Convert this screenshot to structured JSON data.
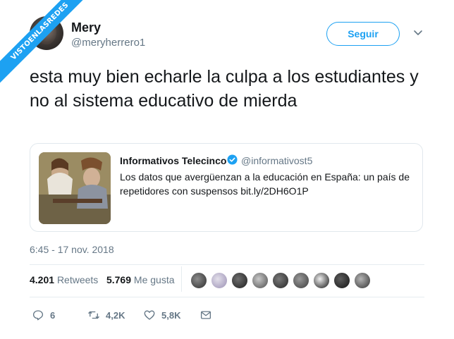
{
  "watermark": "VISTOENLASREDES",
  "author": {
    "name": "Mery",
    "handle": "@meryherrero1",
    "follow_label": "Seguir"
  },
  "tweet": {
    "text": "esta muy bien echarle la culpa a los estudiantes y no al sistema educativo de mierda",
    "timestamp": "6:45 - 17 nov. 2018"
  },
  "quoted": {
    "name": "Informativos Telecinco",
    "handle": "@informativost5",
    "text": "Los datos que avergüenzan a la educación en España: un país de repetidores con suspensos bit.ly/2DH6O1P"
  },
  "stats": {
    "retweets_count": "4.201",
    "retweets_label": "Retweets",
    "likes_count": "5.769",
    "likes_label": "Me gusta"
  },
  "actions": {
    "replies": "6",
    "retweets": "4,2K",
    "likes": "5,8K"
  },
  "colors": {
    "accent": "#1da1f2",
    "secondary_text": "#657786",
    "border": "#e1e8ed"
  },
  "icons": [
    "reply-icon",
    "retweet-icon",
    "like-icon",
    "message-icon",
    "verified-icon",
    "chevron-down-icon"
  ]
}
